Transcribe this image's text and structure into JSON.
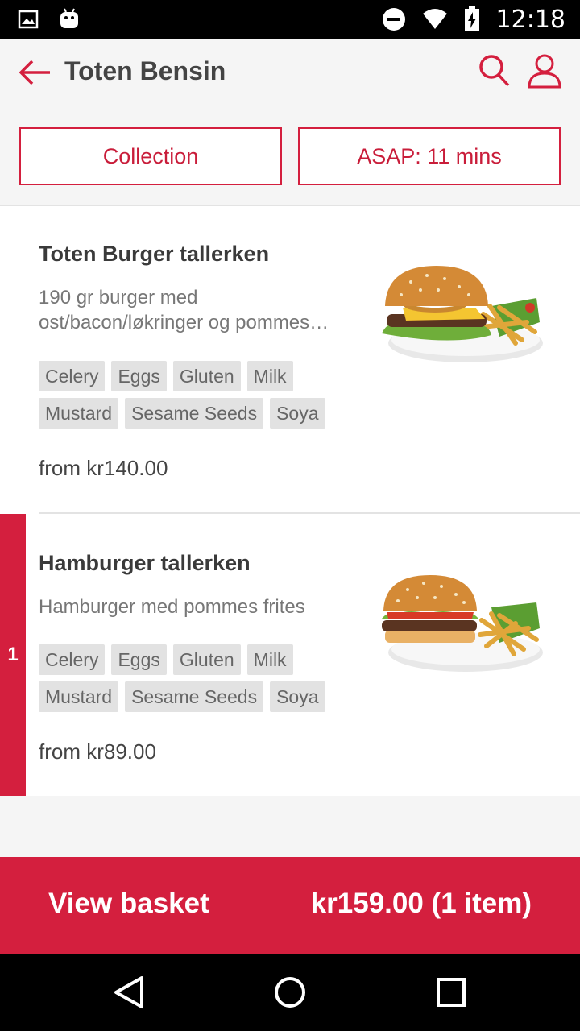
{
  "status_bar": {
    "time": "12:18",
    "icons": [
      "image-icon",
      "android-icon",
      "do-not-disturb-icon",
      "wifi-icon",
      "battery-icon"
    ]
  },
  "header": {
    "title": "Toten Bensin",
    "icons": [
      "back-arrow-icon",
      "search-icon",
      "profile-icon"
    ]
  },
  "order_options": {
    "collection_label": "Collection",
    "time_label": "ASAP: 11 mins"
  },
  "items": [
    {
      "name": "Toten Burger tallerken",
      "description_line1": "190 gr burger med",
      "description_line2": "ost/bacon/løkringer og pommes…",
      "allergens": [
        "Celery",
        "Eggs",
        "Gluten",
        "Milk",
        "Mustard",
        "Sesame Seeds",
        "Soya"
      ],
      "price": "from kr140.00"
    },
    {
      "name": "Hamburger tallerken",
      "description": "Hamburger med pommes frites",
      "allergens": [
        "Celery",
        "Eggs",
        "Gluten",
        "Milk",
        "Mustard",
        "Sesame Seeds",
        "Soya"
      ],
      "price": "from kr89.00",
      "quantity": "1"
    }
  ],
  "basket": {
    "label": "View basket",
    "total": "kr159.00 (1 item)"
  },
  "colors": {
    "accent": "#d41f3e",
    "background": "#f5f5f5",
    "tag_bg": "#e2e2e2"
  },
  "nav_bar": {
    "icons": [
      "back-triangle-icon",
      "home-circle-icon",
      "recents-square-icon"
    ]
  }
}
